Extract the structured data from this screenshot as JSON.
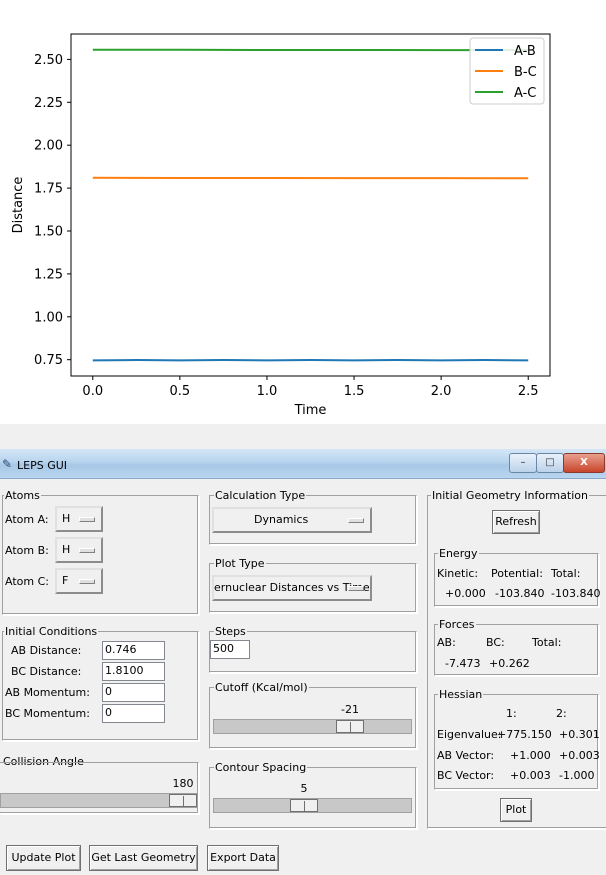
{
  "chart_data": {
    "type": "line",
    "xlabel": "Time",
    "ylabel": "Distance",
    "xlim": [
      -0.125,
      2.625
    ],
    "ylim": [
      0.655,
      2.648
    ],
    "xticks": [
      "0.0",
      "0.5",
      "1.0",
      "1.5",
      "2.0",
      "2.5"
    ],
    "yticks": [
      "0.75",
      "1.00",
      "1.25",
      "1.50",
      "1.75",
      "2.00",
      "2.25",
      "2.50"
    ],
    "legend_position": "top-right",
    "series": [
      {
        "name": "A-B",
        "color": "#1f77b4",
        "x": [
          0,
          0.25,
          0.5,
          0.75,
          1.0,
          1.25,
          1.5,
          1.75,
          2.0,
          2.25,
          2.5
        ],
        "y": [
          0.746,
          0.748,
          0.746,
          0.748,
          0.746,
          0.748,
          0.746,
          0.748,
          0.746,
          0.748,
          0.746
        ]
      },
      {
        "name": "B-C",
        "color": "#ff7f0e",
        "x": [
          0,
          0.5,
          1.0,
          1.5,
          2.0,
          2.5
        ],
        "y": [
          1.81,
          1.809,
          1.809,
          1.808,
          1.808,
          1.807
        ]
      },
      {
        "name": "A-C",
        "color": "#2ca02c",
        "x": [
          0,
          0.5,
          1.0,
          1.5,
          2.0,
          2.5
        ],
        "y": [
          2.556,
          2.556,
          2.555,
          2.555,
          2.554,
          2.554
        ]
      }
    ]
  },
  "window": {
    "title": "LEPS GUI",
    "icon": "feather-icon",
    "controls": {
      "minimize": "–",
      "maximize": "□",
      "close": "X"
    }
  },
  "atoms": {
    "title": "Atoms",
    "a_label": "Atom A:",
    "a_value": "H",
    "b_label": "Atom B:",
    "b_value": "H",
    "c_label": "Atom C:",
    "c_value": "F"
  },
  "calc": {
    "title": "Calculation Type",
    "value": "Dynamics"
  },
  "plot_type": {
    "title": "Plot Type",
    "value": "ernuclear Distances vs Time"
  },
  "init_cond": {
    "title": "Initial Conditions",
    "ab_dist_label": "AB Distance:",
    "ab_dist": "0.746",
    "bc_dist_label": "BC Distance:",
    "bc_dist": "1.8100",
    "ab_mom_label": "AB Momentum:",
    "ab_mom": "0",
    "bc_mom_label": "BC Momentum:",
    "bc_mom": "0"
  },
  "steps": {
    "title": "Steps",
    "value": "500"
  },
  "cutoff": {
    "title": "Cutoff (Kcal/mol)",
    "value": "-21",
    "fraction": 0.72
  },
  "collision": {
    "title": "Collision Angle",
    "value": "180",
    "fraction": 1.0
  },
  "contour": {
    "title": "Contour Spacing",
    "value": "5",
    "fraction": 0.45
  },
  "geom": {
    "title": "Initial Geometry Information",
    "refresh": "Refresh",
    "energy": {
      "title": "Energy",
      "kinetic_label": "Kinetic:",
      "potential_label": "Potential:",
      "total_label": "Total:",
      "kinetic": "+0.000",
      "potential": "-103.840",
      "total": "-103.840"
    },
    "forces": {
      "title": "Forces",
      "ab_label": "AB:",
      "bc_label": "BC:",
      "total_label": "Total:",
      "ab": "-7.473",
      "bc": "+0.262"
    },
    "hessian": {
      "title": "Hessian",
      "col1": "1:",
      "col2": "2:",
      "eig_label": "Eigenvalue:",
      "eig1": "+775.150",
      "eig2": "+0.301",
      "ab_label": "AB Vector:",
      "ab1": "+1.000",
      "ab2": "+0.003",
      "bc_label": "BC Vector:",
      "bc1": "+0.003",
      "bc2": "-1.000"
    },
    "plot": "Plot"
  },
  "bottom": {
    "update": "Update Plot",
    "last": "Get Last Geometry",
    "export": "Export Data"
  }
}
